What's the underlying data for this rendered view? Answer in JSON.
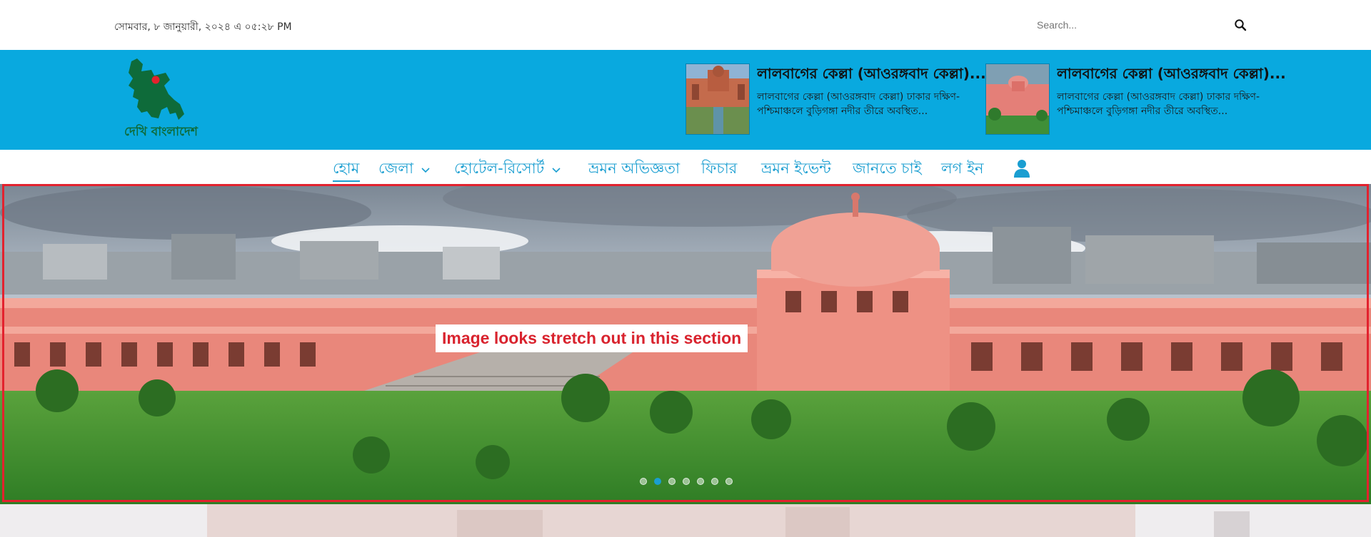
{
  "topbar": {
    "date_text": "সোমবার, ৮ জানুয়ারী, ২০২৪ এ ০৫:২৮ PM",
    "search_placeholder": "Search..."
  },
  "header": {
    "logo_text": "দেখি বাংলাদেশ",
    "cards": [
      {
        "title": "লালবাগের কেল্লা (আওরঙ্গবাদ কেল্লা)...",
        "description": "লালবাগের কেল্লা (আওরঙ্গবাদ কেল্লা) ঢাকার দক্ষিণ-পশ্চিমাঞ্চলে বুড়িগঙ্গা নদীর তীরে অবস্থিত..."
      },
      {
        "title": "লালবাগের কেল্লা (আওরঙ্গবাদ কেল্লা)...",
        "description": "লালবাগের কেল্লা (আওরঙ্গবাদ কেল্লা) ঢাকার দক্ষিণ-পশ্চিমাঞ্চলে বুড়িগঙ্গা নদীর তীরে অবস্থিত..."
      }
    ]
  },
  "nav": {
    "items": [
      {
        "label": "হোম",
        "active": true
      },
      {
        "label": "জেলা",
        "dropdown": true
      },
      {
        "label": "হোটেল-রিসোর্ট",
        "dropdown": true
      },
      {
        "label": "ভ্রমন অভিজ্ঞতা"
      },
      {
        "label": "ফিচার"
      },
      {
        "label": "ভ্রমন ইভেন্ট"
      },
      {
        "label": "জানতে চাই"
      },
      {
        "label": "লগ ইন"
      }
    ]
  },
  "hero": {
    "annotation": "Image looks stretch out in this section",
    "slide_count": 7,
    "active_slide": 2
  },
  "colors": {
    "header_bg": "#09a9df",
    "nav_text": "#1a9ed1",
    "annotation_red": "#e3222e"
  }
}
